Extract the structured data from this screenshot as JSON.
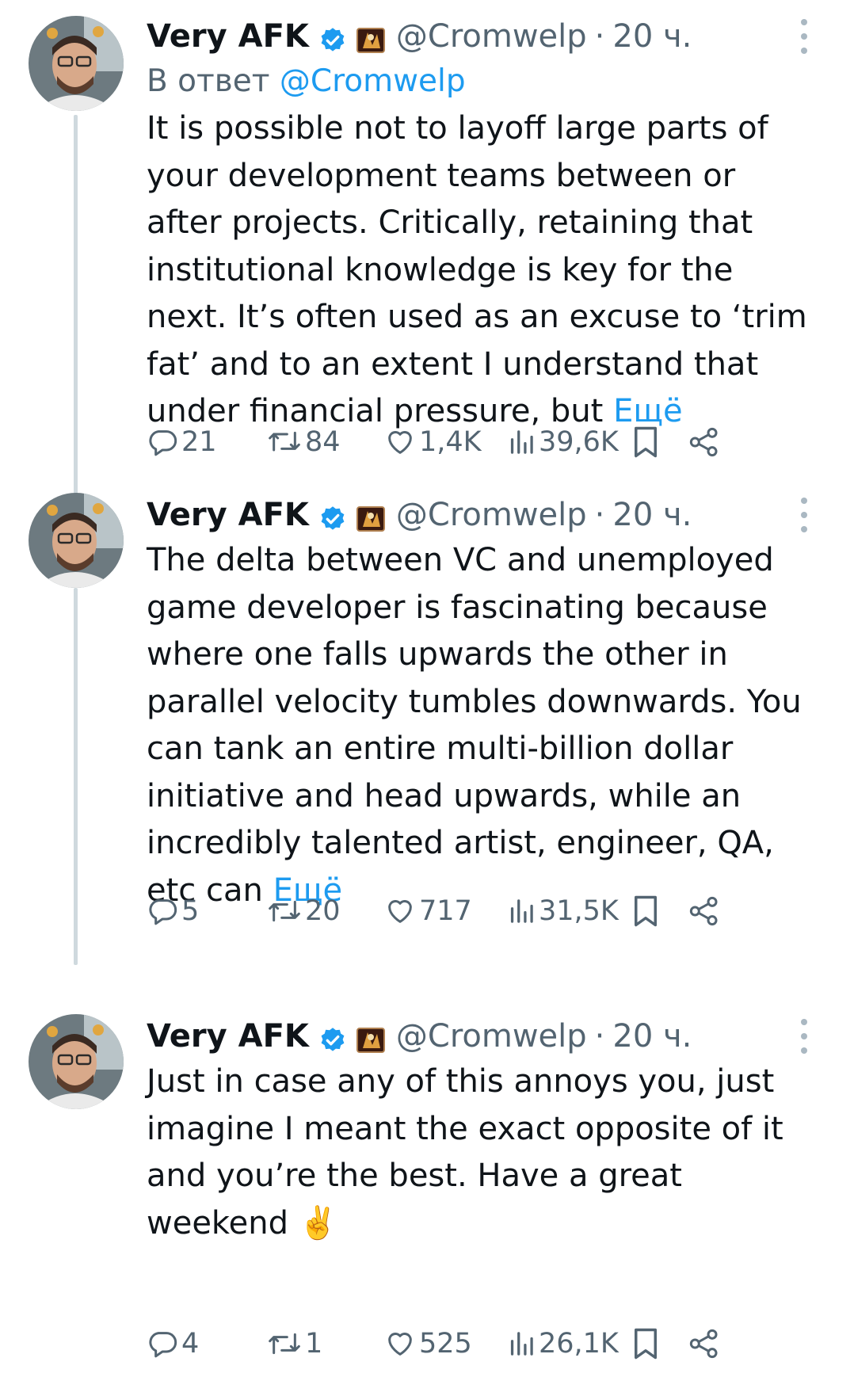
{
  "tweets": [
    {
      "author_name": "Very AFK",
      "handle": "@Cromwelp",
      "separator": "·",
      "time": "20 ч.",
      "reply_prefix": "В ответ",
      "reply_mention": "@Cromwelp",
      "text": "It is possible not to layoff large parts of\nyour development teams between or\nafter projects. Critically, retaining that\ninstitutional knowledge is key for the\nnext. It’s often used as an excuse to ‘trim\nfat’ and to an extent I understand that\nunder financial pressure, but",
      "more_label": "Ещё",
      "replies": "21",
      "retweets": "84",
      "likes": "1,4K",
      "views": "39,6K"
    },
    {
      "author_name": "Very AFK",
      "handle": "@Cromwelp",
      "separator": "·",
      "time": "20 ч.",
      "text": "The delta between VC and unemployed\ngame developer is fascinating because\nwhere one falls upwards the other in\nparallel velocity tumbles downwards. You\ncan tank an entire multi-billion dollar\ninitiative and head upwards, while an\nincredibly talented artist, engineer, QA,\netc can",
      "more_label": "Ещё",
      "replies": "5",
      "retweets": "20",
      "likes": "717",
      "views": "31,5K"
    },
    {
      "author_name": "Very AFK",
      "handle": "@Cromwelp",
      "separator": "·",
      "time": "20 ч.",
      "text": "Just in case any of this annoys you, just\nimagine I meant the exact opposite of it\nand you’re the best. Have a great\nweekend ✌️",
      "replies": "4",
      "retweets": "1",
      "likes": "525",
      "views": "26,1K"
    }
  ],
  "icons": {
    "verified": "verified-badge-icon",
    "affiliation": "affiliate-logo-icon",
    "reply": "reply-icon",
    "retweet": "retweet-icon",
    "like": "heart-icon",
    "views": "views-icon",
    "bookmark": "bookmark-icon",
    "share": "share-icon",
    "more": "more-vertical-icon"
  },
  "colors": {
    "link": "#1d9bf0",
    "secondary_text": "#536471",
    "thread_line": "#cfd9de"
  }
}
